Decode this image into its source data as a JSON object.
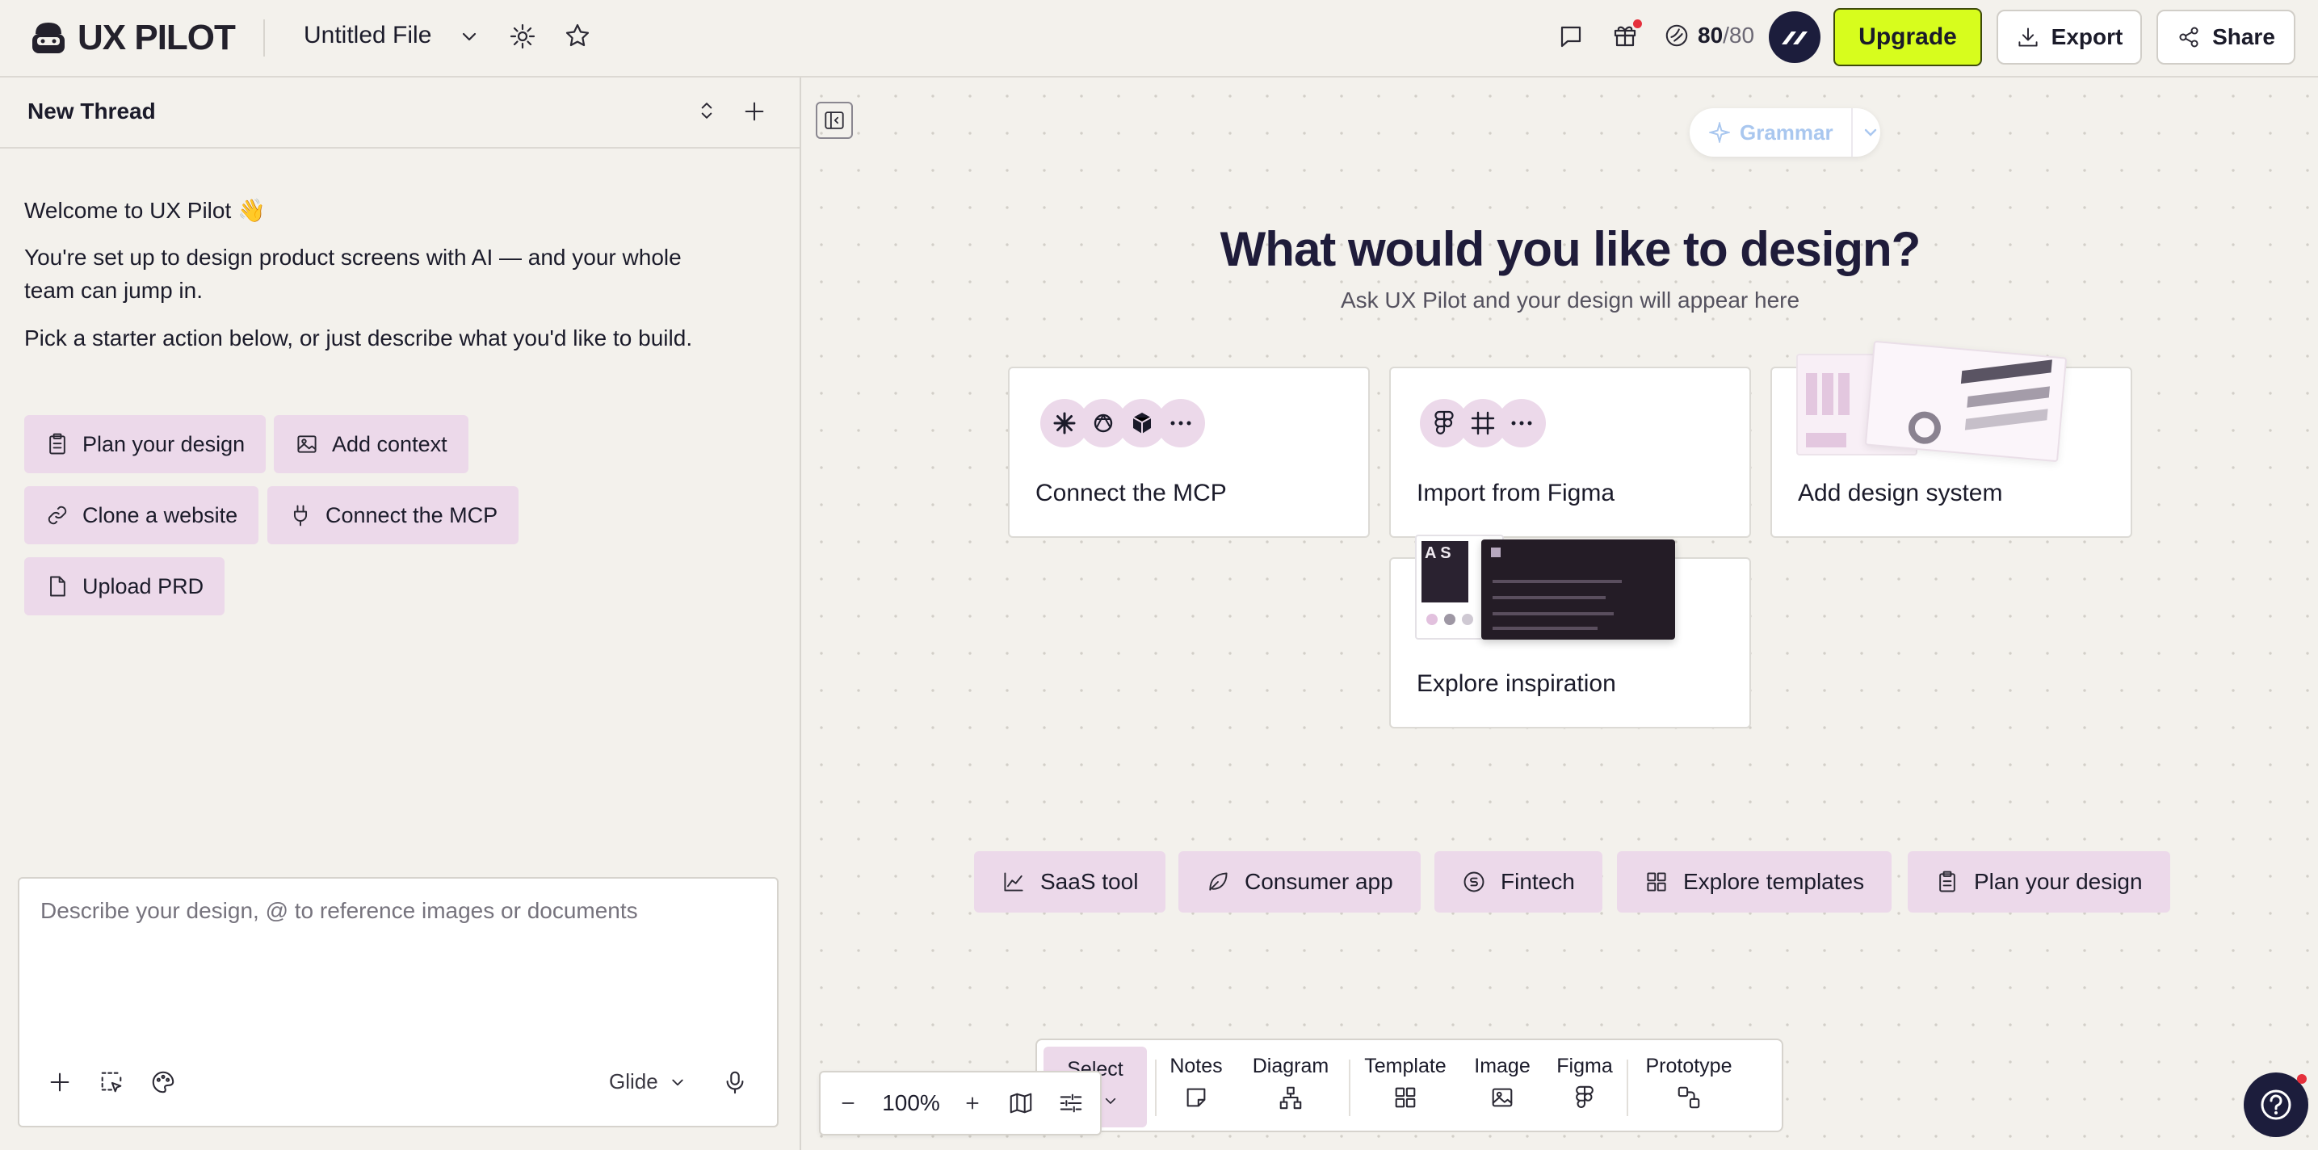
{
  "app": {
    "logo_text": "UX PILOT",
    "file_name": "Untitled File"
  },
  "header": {
    "credits_used": "80",
    "credits_total": "/80",
    "upgrade_label": "Upgrade",
    "export_label": "Export",
    "share_label": "Share",
    "accent_color": "#d7fd1d"
  },
  "thread": {
    "title": "New Thread"
  },
  "welcome": {
    "heading": "Welcome to UX Pilot 👋",
    "line1": "You're set up to design product screens with AI — and your whole team can jump in.",
    "line2": "Pick a starter action below, or just describe what you'd like to build."
  },
  "starter_actions": [
    "Plan your design",
    "Add context",
    "Clone a website",
    "Connect the MCP",
    "Upload PRD"
  ],
  "composer": {
    "placeholder": "Describe your design, @ to reference images or documents",
    "model": "Glide"
  },
  "canvas": {
    "grammar_label": "Grammar",
    "headline": "What would you like to design?",
    "subline": "Ask UX Pilot and your design will appear here",
    "cards": [
      "Connect the MCP",
      "Import from Figma",
      "Add design system",
      "Explore inspiration"
    ],
    "templates": [
      "SaaS tool",
      "Consumer app",
      "Fintech",
      "Explore templates",
      "Plan your design"
    ]
  },
  "toolbar": {
    "zoom": "100%",
    "select": "Select",
    "notes": "Notes",
    "diagram": "Diagram",
    "template": "Template",
    "image": "Image",
    "figma": "Figma",
    "prototype": "Prototype"
  },
  "colors": {
    "chip_bg": "#ecd9ea",
    "background": "#f3f1ec",
    "headline": "#1f1c3a"
  }
}
